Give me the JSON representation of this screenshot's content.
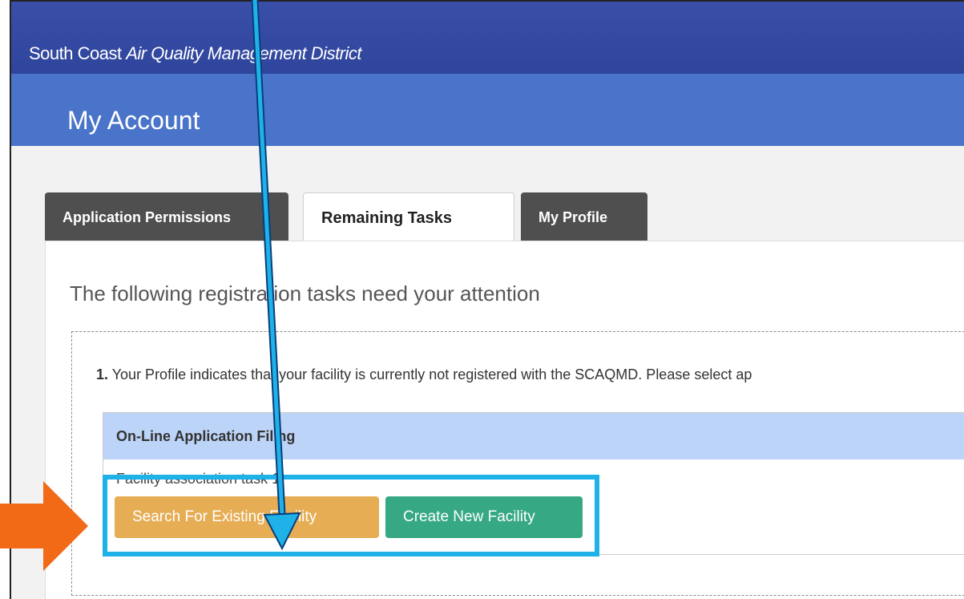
{
  "header": {
    "brand_regular": "South Coast ",
    "brand_italic": "Air Quality Management District"
  },
  "page": {
    "title": "My Account"
  },
  "tabs": [
    {
      "label": "Application Permissions",
      "active": false
    },
    {
      "label": "Remaining Tasks",
      "active": true
    },
    {
      "label": "My Profile",
      "active": false
    }
  ],
  "panel": {
    "intro": "The following registration tasks need your attention",
    "task": {
      "number": "1.",
      "text": " Your Profile indicates that your facility is currently not registered with the SCAQMD. Please select ap"
    },
    "table": {
      "header": "On-Line Application Filing",
      "row_label": "Facility association task 1"
    },
    "buttons": {
      "search": "Search For Existing Facility",
      "create": "Create New Facility"
    }
  },
  "annotations": {
    "highlight_color": "#1fb2e8",
    "pointer_arrow_color": "#f26a16"
  }
}
